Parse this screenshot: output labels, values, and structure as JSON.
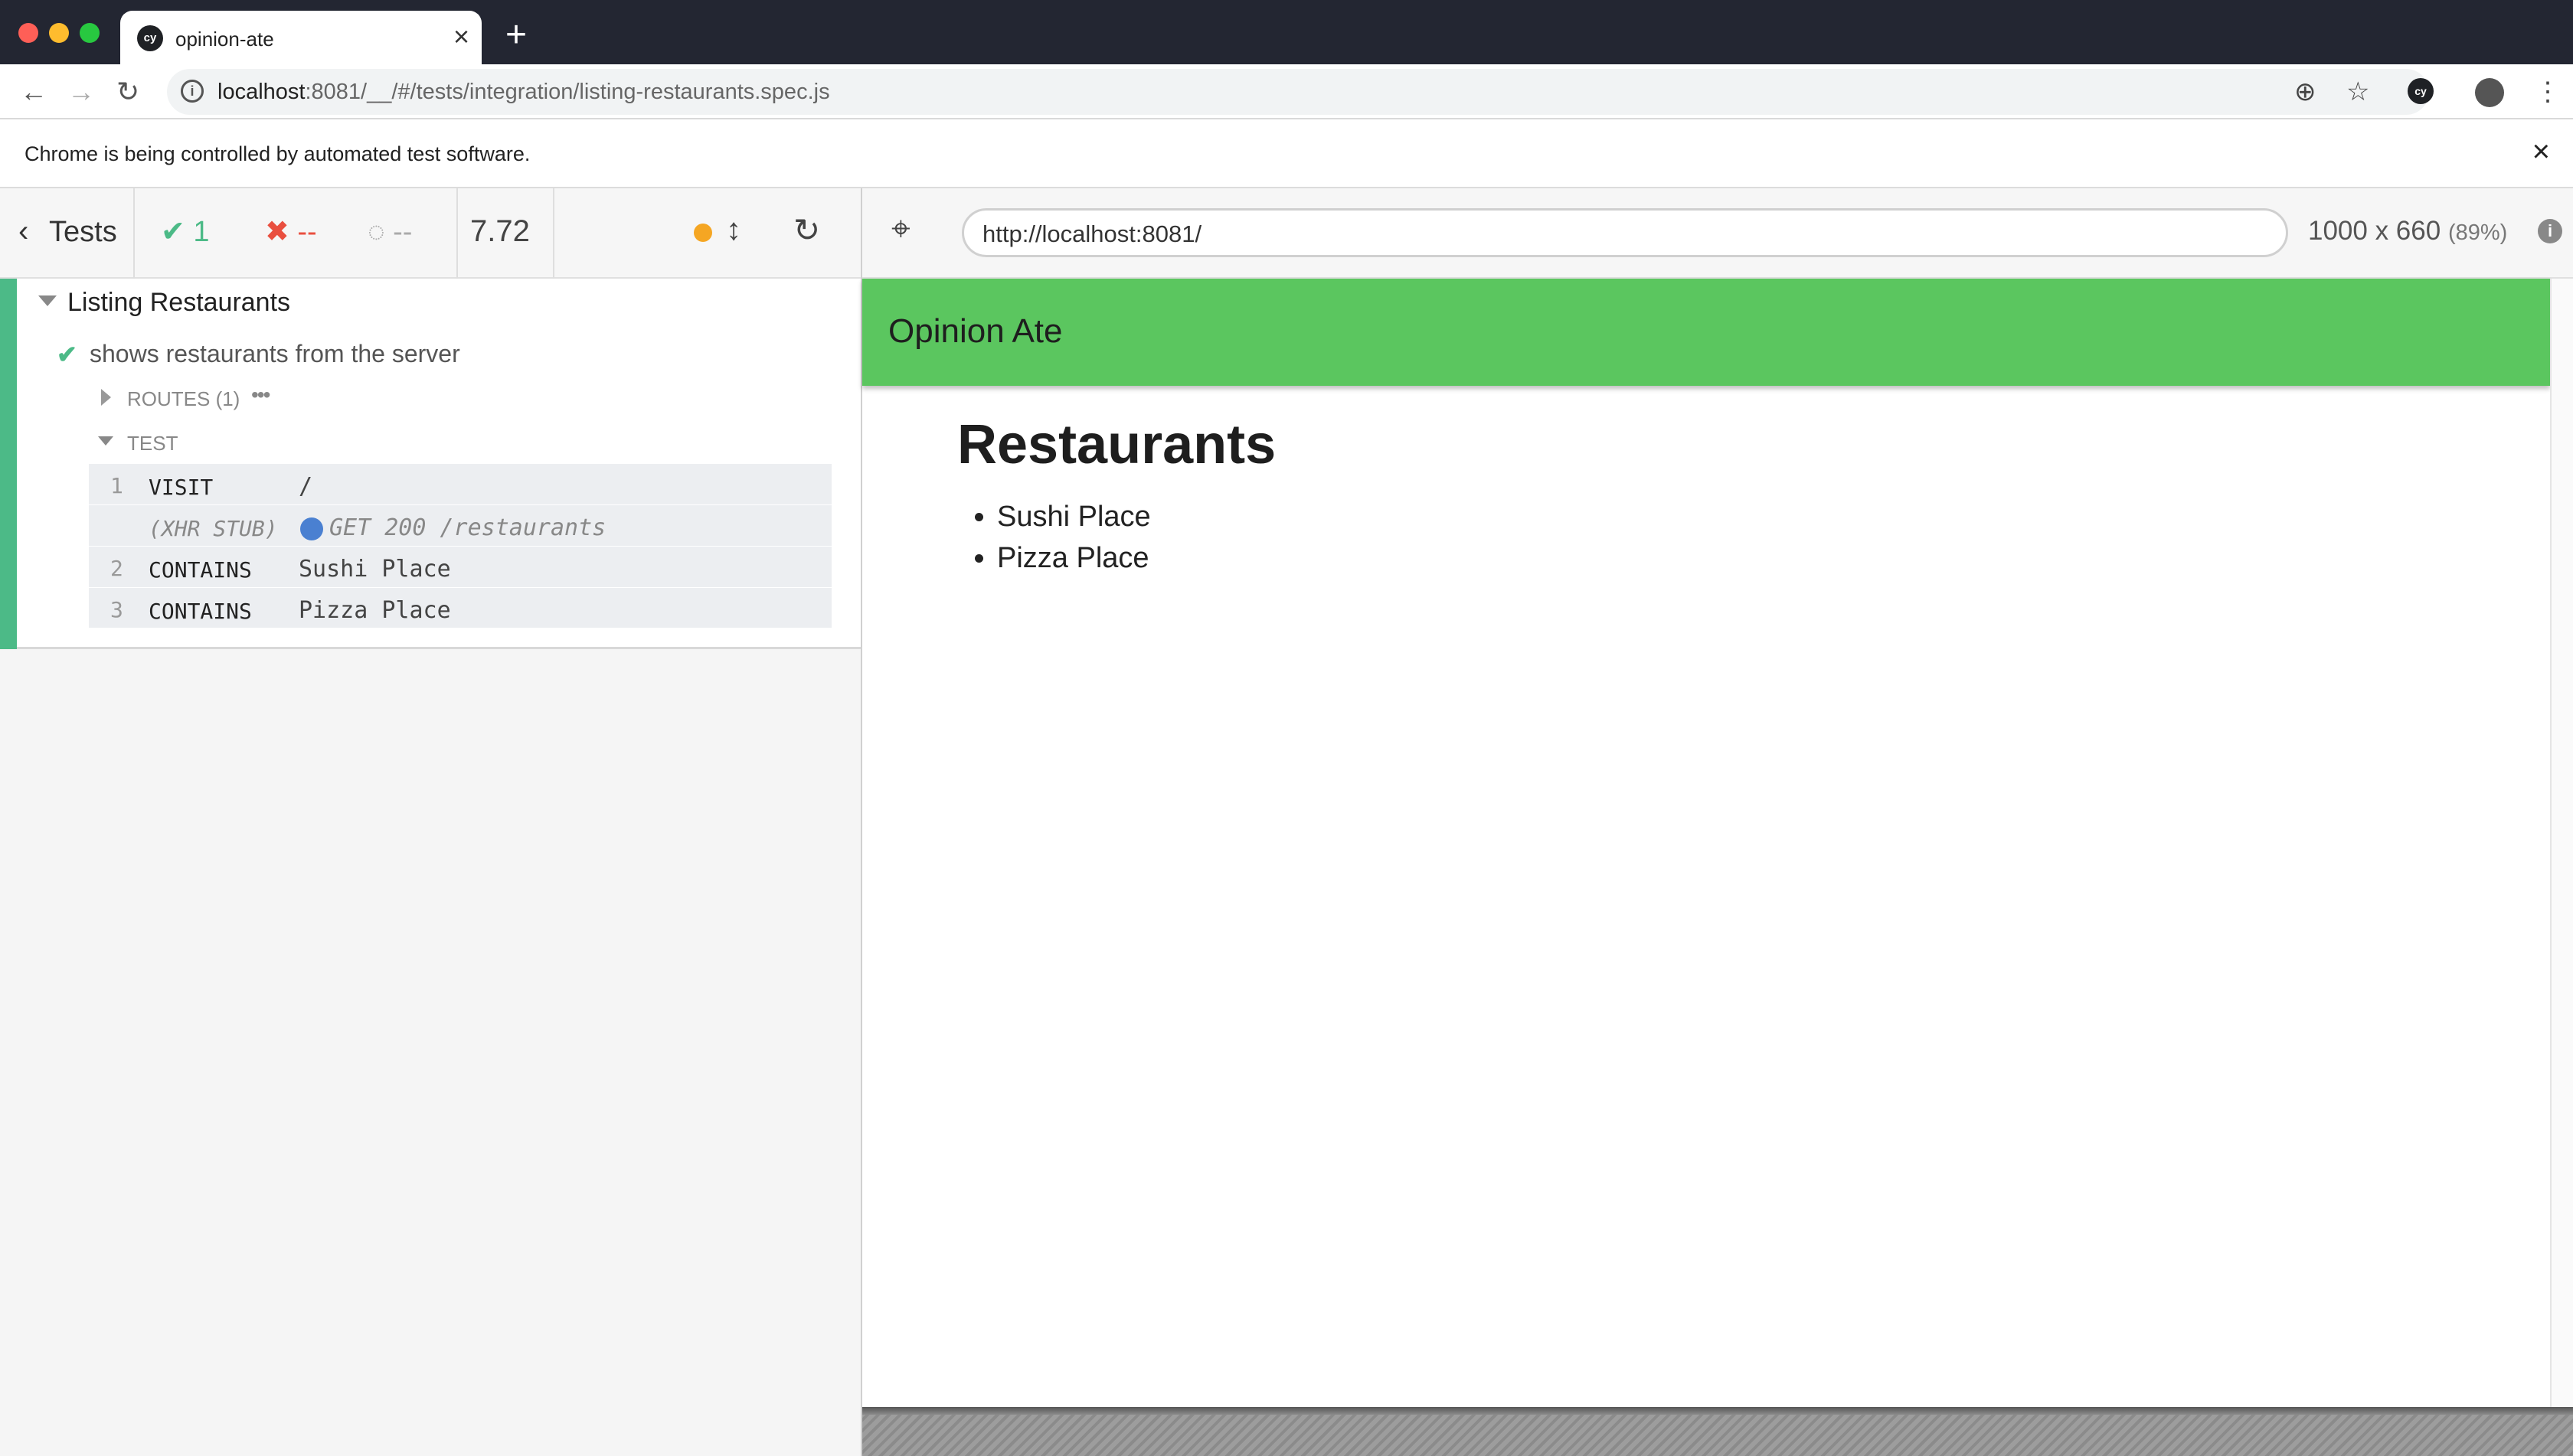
{
  "browser": {
    "tab_title": "opinion-ate",
    "tab_favicon": "cy",
    "url_host": "localhost",
    "url_rest": ":8081/__/#/tests/integration/listing-restaurants.spec.js",
    "infobar_text": "Chrome is being controlled by automated test software.",
    "extension_badge": "cy"
  },
  "runner": {
    "tests_label": "Tests",
    "passed": "1",
    "failed": "--",
    "pending": "--",
    "duration": "7.72",
    "aut_url": "http://localhost:8081/",
    "viewport_size": "1000 x 660",
    "viewport_scale": "(89%)"
  },
  "reporter": {
    "suite_title": "Listing Restaurants",
    "test_title": "shows restaurants from the server",
    "routes_label": "ROUTES (1)",
    "test_section_label": "TEST",
    "commands": [
      {
        "num": "1",
        "name": "VISIT",
        "message": "/"
      },
      {
        "num": "",
        "name": "(XHR STUB)",
        "message": "GET 200 /restaurants"
      },
      {
        "num": "2",
        "name": "CONTAINS",
        "message": "Sushi Place"
      },
      {
        "num": "3",
        "name": "CONTAINS",
        "message": "Pizza Place"
      }
    ]
  },
  "app": {
    "bar_title": "Opinion Ate",
    "heading": "Restaurants",
    "restaurants": [
      "Sushi Place",
      "Pizza Place"
    ]
  },
  "colors": {
    "pass": "#4cba87",
    "fail": "#e94f3f",
    "app_bar": "#5bc65f",
    "xhr_dot": "#4a80d1",
    "running_dot": "#f5a623"
  }
}
